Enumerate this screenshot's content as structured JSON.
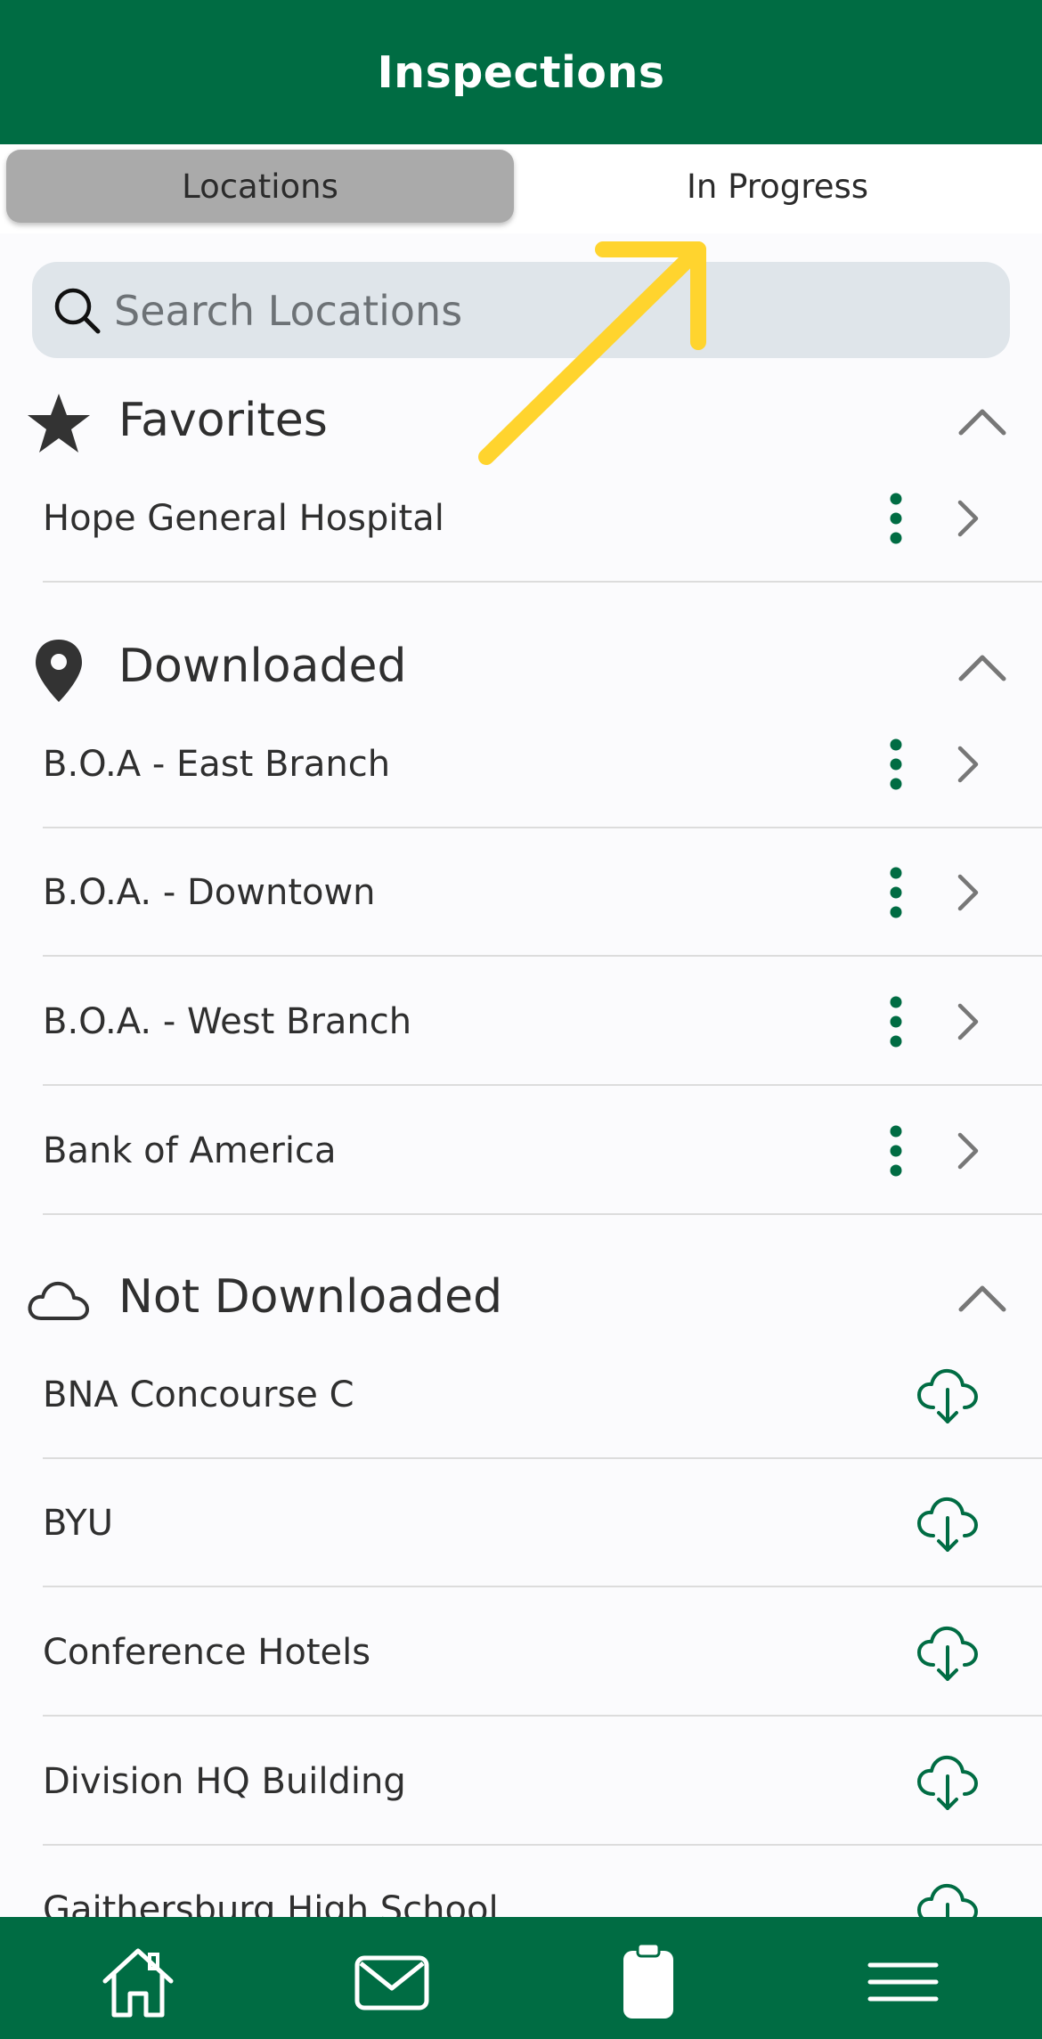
{
  "header": {
    "title": "Inspections"
  },
  "segments": [
    {
      "label": "Locations"
    },
    {
      "label": "In Progress"
    }
  ],
  "search": {
    "placeholder": "Search Locations",
    "value": ""
  },
  "sections": {
    "favorites": {
      "title": "Favorites",
      "icon": "star-icon",
      "items": [
        {
          "label": "Hope General Hospital"
        }
      ]
    },
    "downloaded": {
      "title": "Downloaded",
      "icon": "map-pin-icon",
      "items": [
        {
          "label": "B.O.A - East Branch"
        },
        {
          "label": "B.O.A. - Downtown"
        },
        {
          "label": "B.O.A. - West Branch"
        },
        {
          "label": "Bank of America"
        }
      ]
    },
    "not_downloaded": {
      "title": "Not Downloaded",
      "icon": "cloud-icon",
      "items": [
        {
          "label": "BNA Concourse C"
        },
        {
          "label": "BYU"
        },
        {
          "label": "Conference Hotels"
        },
        {
          "label": "Division HQ Building"
        },
        {
          "label": "Gaithersburg High School"
        }
      ]
    }
  },
  "tabbar": {
    "icons": [
      "home-icon",
      "mail-icon",
      "clipboard-icon",
      "menu-icon"
    ]
  },
  "colors": {
    "brand_green": "#006c43",
    "active_segment": "#aaaaaa",
    "search_bg": "#dfe5ea",
    "annotation_arrow": "#ffd42e"
  }
}
